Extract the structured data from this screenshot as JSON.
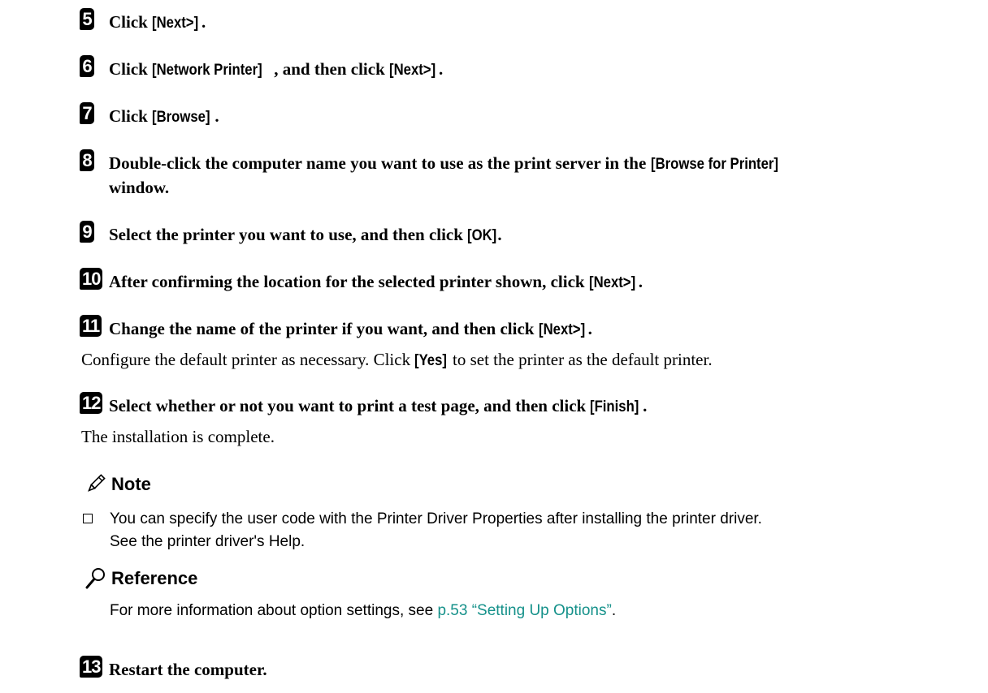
{
  "steps": [
    {
      "num": "5",
      "pre": "Click ",
      "btn": "[Next>]",
      "post": "."
    },
    {
      "num": "6",
      "pre": "Click ",
      "btn": "[Network Printer]",
      "mid": ", and then click ",
      "btn2": "[Next>]",
      "post": "."
    },
    {
      "num": "7",
      "pre": "Click ",
      "btn": "[Browse]",
      "post": "."
    },
    {
      "num": "8",
      "pre": "Double-click the computer name you want to use as the print server in the ",
      "btn": "[Browse for Printer]",
      "line2": "window."
    },
    {
      "num": "9",
      "pre": "Select the printer you want to use, and then click ",
      "btn": "[OK]",
      "post": "."
    },
    {
      "num": "10",
      "pre": "After confirming the location for the selected printer shown, click ",
      "btn": "[Next>]",
      "post": "."
    },
    {
      "num": "11",
      "pre": "Change the name of the printer if you want, and then click ",
      "btn": "[Next>]",
      "post": ".",
      "body_pre": "Configure the default printer as necessary. Click ",
      "body_btn": "[Yes]",
      "body_post": " to set the printer as the default printer."
    },
    {
      "num": "12",
      "pre": "Select whether or not you want to print a test page, and then click ",
      "btn": "[Finish]",
      "post": ".",
      "body": "The installation is complete."
    },
    {
      "num": "13",
      "pre": "Restart the computer."
    }
  ],
  "note": {
    "title": "Note",
    "line1": "You can specify the user code with the Printer Driver Properties after installing the printer driver.",
    "line2": "See the printer driver's Help."
  },
  "reference": {
    "title": "Reference",
    "pre": "For more information about option settings, see ",
    "link": "p.53 “Setting Up Options”",
    "post": "."
  },
  "colors": {
    "link": "#15918a",
    "text": "#000000"
  },
  "icons": {
    "note": "pencil-icon",
    "reference": "magnifier-icon"
  }
}
